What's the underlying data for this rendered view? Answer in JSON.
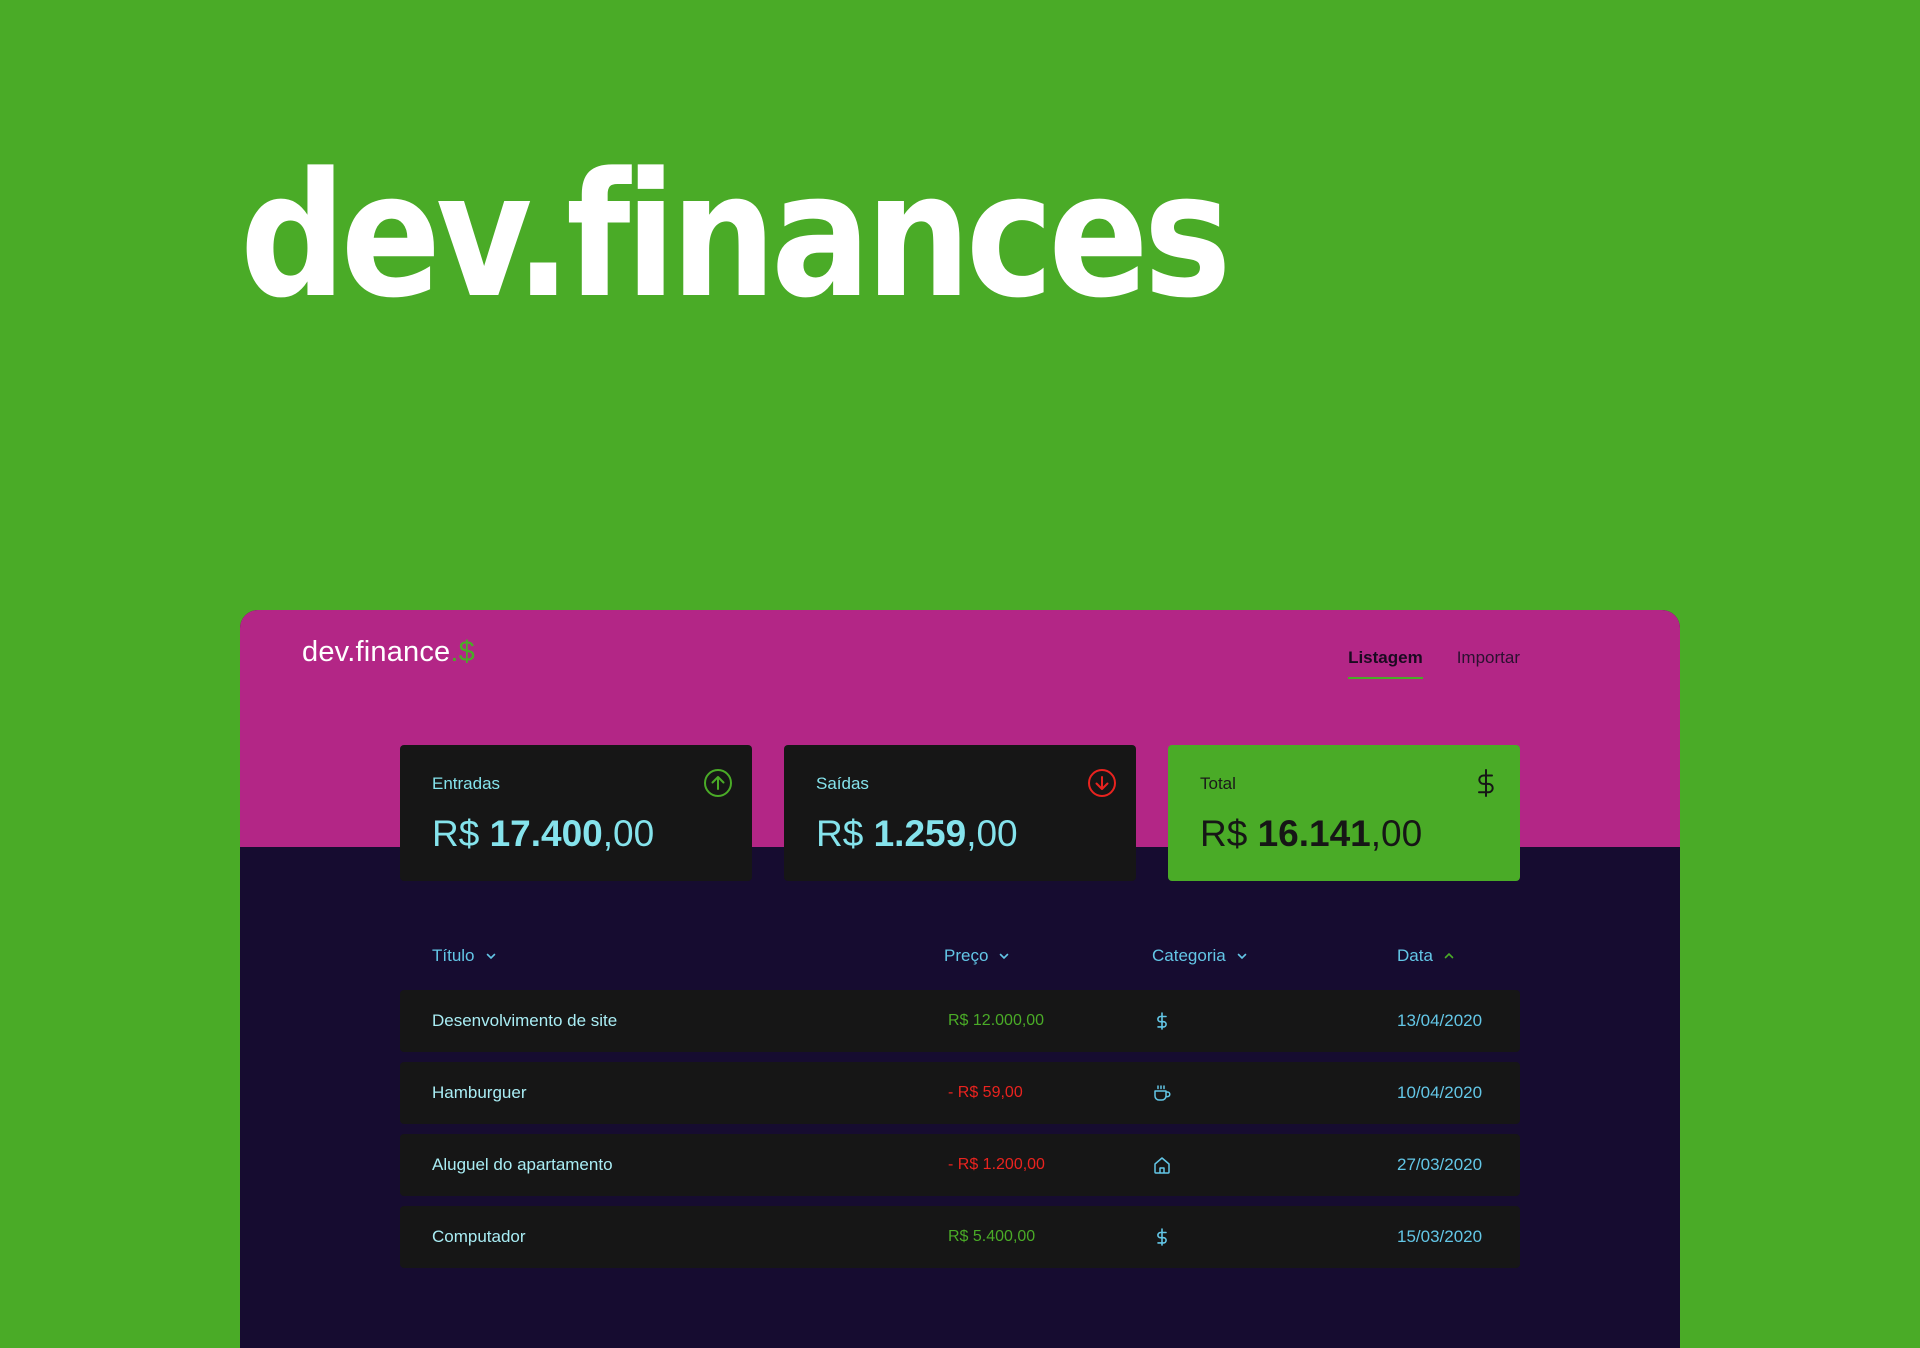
{
  "hero": {
    "title": "dev.finances"
  },
  "app": {
    "logo": {
      "text": "dev.finance",
      "dot": ".",
      "symbol": "$"
    },
    "nav": [
      {
        "label": "Listagem",
        "active": true
      },
      {
        "label": "Importar",
        "active": false
      }
    ],
    "cards": [
      {
        "label": "Entradas",
        "currency": "R$",
        "amount_bold": "17.400",
        "amount_cents": ",00",
        "icon": "arrow-up-circle-icon",
        "icon_color": "#4aab27"
      },
      {
        "label": "Saídas",
        "currency": "R$",
        "amount_bold": "1.259",
        "amount_cents": ",00",
        "icon": "arrow-down-circle-icon",
        "icon_color": "#e9231f"
      },
      {
        "label": "Total",
        "currency": "R$",
        "amount_bold": "16.141",
        "amount_cents": ",00",
        "icon": "dollar-icon",
        "icon_color": "#161616"
      }
    ],
    "table": {
      "columns": [
        {
          "label": "Título",
          "sort": "down"
        },
        {
          "label": "Preço",
          "sort": "down"
        },
        {
          "label": "Categoria",
          "sort": "down"
        },
        {
          "label": "Data",
          "sort": "up"
        }
      ],
      "rows": [
        {
          "title": "Desenvolvimento de site",
          "price": "R$ 12.000,00",
          "type": "in",
          "category_icon": "dollar-icon",
          "date": "13/04/2020"
        },
        {
          "title": "Hamburguer",
          "price": "- R$ 59,00",
          "type": "out",
          "category_icon": "coffee-icon",
          "date": "10/04/2020"
        },
        {
          "title": "Aluguel do apartamento",
          "price": "- R$ 1.200,00",
          "type": "out",
          "category_icon": "home-icon",
          "date": "27/03/2020"
        },
        {
          "title": "Computador",
          "price": "R$ 5.400,00",
          "type": "in",
          "category_icon": "dollar-icon",
          "date": "15/03/2020"
        }
      ]
    }
  },
  "colors": {
    "background": "#4aab27",
    "header": "#b32686",
    "panel": "#160c30",
    "card": "#161616",
    "income": "#4aab27",
    "outcome": "#e9231f",
    "accent": "#63c6e6"
  }
}
